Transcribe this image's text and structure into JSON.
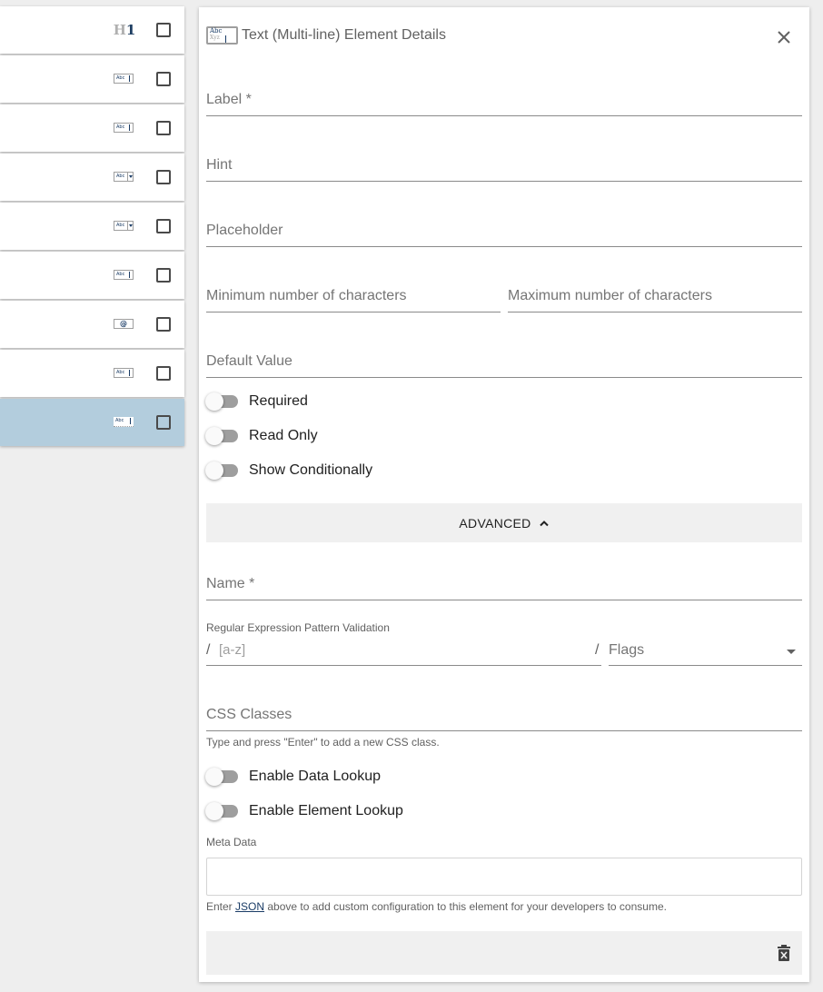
{
  "element_list": {
    "items": [
      {
        "icon": "heading-icon",
        "h_text": "H",
        "one_text": "1",
        "selected": false
      },
      {
        "icon": "text-field-icon",
        "mini": "Abc",
        "selected": false
      },
      {
        "icon": "text-field-icon",
        "mini": "Abc",
        "selected": false
      },
      {
        "icon": "dropdown-field-icon",
        "mini": "Abc",
        "selected": false
      },
      {
        "icon": "dropdown-field-icon",
        "mini": "Abc",
        "selected": false
      },
      {
        "icon": "text-field-icon",
        "mini": "Abc",
        "selected": false
      },
      {
        "icon": "email-field-icon",
        "mini": "@",
        "selected": false
      },
      {
        "icon": "text-field-icon",
        "mini": "Abc",
        "selected": false
      },
      {
        "icon": "multiline-text-icon",
        "mini": "Abc",
        "selected": true
      }
    ]
  },
  "panel": {
    "icon": "multiline-text-icon",
    "icon_abc": "Abc",
    "icon_xyz": "Xyz",
    "title": "Text (Multi-line) Element Details",
    "close_icon": "close-icon",
    "fields": {
      "label": "Label *",
      "hint": "Hint",
      "placeholder": "Placeholder",
      "min_chars": "Minimum number of characters",
      "max_chars": "Maximum number of characters",
      "default_value": "Default Value"
    },
    "toggles": {
      "required": {
        "label": "Required",
        "on": false
      },
      "read_only": {
        "label": "Read Only",
        "on": false
      },
      "show_conditionally": {
        "label": "Show Conditionally",
        "on": false
      }
    },
    "advanced": {
      "label": "ADVANCED",
      "expanded": true,
      "icon": "chevron-up-icon"
    },
    "advanced_fields": {
      "name": "Name *",
      "regex_caption": "Regular Expression Pattern Validation",
      "regex_slash": "/",
      "regex_placeholder": "[a-z]",
      "flags_label": "Flags",
      "css_classes": "CSS Classes",
      "css_help": "Type and press \"Enter\" to add a new CSS class."
    },
    "lookup_toggles": {
      "data_lookup": {
        "label": "Enable Data Lookup",
        "on": false
      },
      "element_lookup": {
        "label": "Enable Element Lookup",
        "on": false
      }
    },
    "meta": {
      "caption": "Meta Data",
      "value": "",
      "help_prefix": "Enter ",
      "help_link": "JSON",
      "help_suffix": " above to add custom configuration to this element for your developers to consume."
    },
    "footer": {
      "delete_icon": "delete-icon"
    }
  },
  "colors": {
    "selected_row": "#b3cddd",
    "brand_dark": "#1a3c66",
    "toggle_off_track": "#9e9e9e"
  }
}
